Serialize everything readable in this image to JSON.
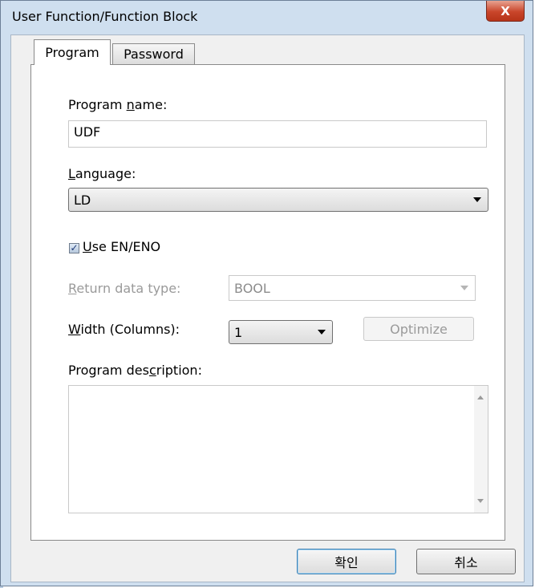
{
  "window": {
    "title": "User Function/Function Block",
    "close_label": "X"
  },
  "tabs": [
    {
      "label": "Program",
      "active": true
    },
    {
      "label": "Password",
      "active": false
    }
  ],
  "program_name": {
    "label_pre": "Program ",
    "label_mnemonic": "n",
    "label_post": "ame:",
    "value": "UDF"
  },
  "language": {
    "label_mnemonic": "L",
    "label_post": "anguage:",
    "selected": "LD"
  },
  "use_en_eno": {
    "label_mnemonic": "U",
    "label_post": "se EN/ENO",
    "checked": true
  },
  "return_data_type": {
    "label_mnemonic": "R",
    "label_post": "eturn data type:",
    "selected": "BOOL",
    "enabled": false
  },
  "width_columns": {
    "label_mnemonic": "W",
    "label_post": "idth (Columns):",
    "selected": "1"
  },
  "optimize_label": "Optimize",
  "program_description": {
    "label_pre": "Program des",
    "label_mnemonic": "c",
    "label_post": "ription:",
    "value": ""
  },
  "footer": {
    "ok_label": "확인",
    "cancel_label": "취소"
  },
  "colors": {
    "frame": "#cfdfef",
    "close": "#c9452a",
    "disabled_text": "#9a9a9a"
  }
}
